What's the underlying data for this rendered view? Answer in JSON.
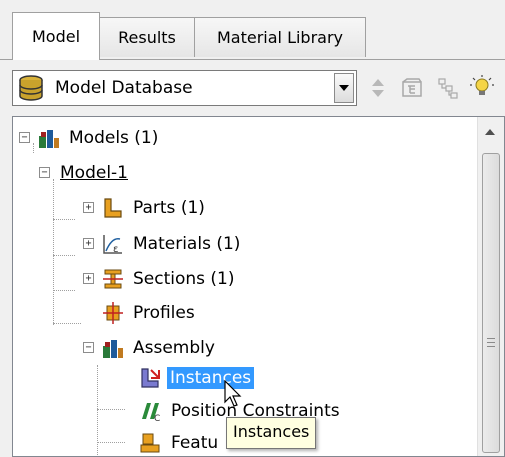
{
  "tabs": [
    {
      "label": "Model",
      "active": true
    },
    {
      "label": "Results",
      "active": false
    },
    {
      "label": "Material Library",
      "active": false
    }
  ],
  "toolbar": {
    "combo_value": "Model Database",
    "buttons": [
      "up-down-arrows-icon",
      "expand-icon",
      "tree-icon",
      "lightbulb-icon"
    ]
  },
  "tree": {
    "models": "Models (1)",
    "model1": "Model-1",
    "parts": "Parts (1)",
    "materials": "Materials (1)",
    "sections": "Sections (1)",
    "profiles": "Profiles",
    "assembly": "Assembly",
    "instances": "Instances",
    "position_constraints": "Position Constraints",
    "features": "Featu"
  },
  "tooltip": "Instances",
  "colors": {
    "selection": "#3399ff",
    "tooltip_bg": "#ffffe1"
  }
}
